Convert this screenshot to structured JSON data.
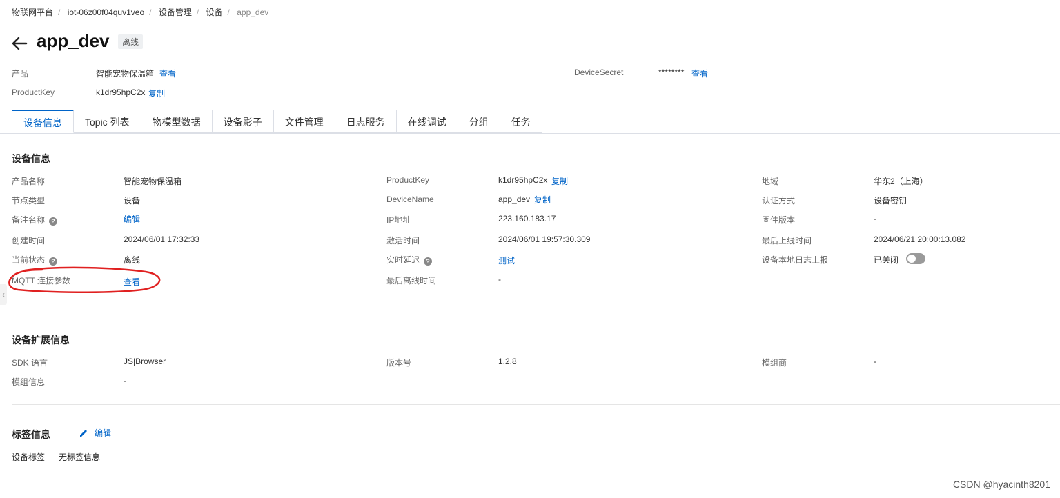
{
  "breadcrumb": [
    "物联网平台",
    "iot-06z00f04quv1veo",
    "设备管理",
    "设备",
    "app_dev"
  ],
  "device": {
    "name": "app_dev",
    "status": "离线"
  },
  "summary": {
    "product_label": "产品",
    "product_value": "智能宠物保温箱",
    "product_link": "查看",
    "productkey_label": "ProductKey",
    "productkey_value": "k1dr95hpC2x",
    "productkey_link": "复制",
    "secret_label": "DeviceSecret",
    "secret_value": "********",
    "secret_link": "查看"
  },
  "tabs": [
    "设备信息",
    "Topic 列表",
    "物模型数据",
    "设备影子",
    "文件管理",
    "日志服务",
    "在线调试",
    "分组",
    "任务"
  ],
  "device_info": {
    "title": "设备信息",
    "col1": [
      {
        "label": "产品名称",
        "value": "智能宠物保温箱"
      },
      {
        "label": "节点类型",
        "value": "设备"
      },
      {
        "label": "备注名称",
        "value": "编辑"
      },
      {
        "label": "创建时间",
        "value": "2024/06/01 17:32:33"
      },
      {
        "label": "当前状态",
        "value": "离线"
      },
      {
        "label": "MQTT 连接参数",
        "value": "查看"
      }
    ],
    "col2": [
      {
        "label": "ProductKey",
        "value": "k1dr95hpC2x",
        "link": "复制"
      },
      {
        "label": "DeviceName",
        "value": "app_dev",
        "link": "复制"
      },
      {
        "label": "IP地址",
        "value": "223.160.183.17"
      },
      {
        "label": "激活时间",
        "value": "2024/06/01 19:57:30.309"
      },
      {
        "label": "实时延迟",
        "value": "测试"
      },
      {
        "label": "最后离线时间",
        "value": "-"
      }
    ],
    "col3": [
      {
        "label": "地域",
        "value": "华东2（上海）"
      },
      {
        "label": "认证方式",
        "value": "设备密钥"
      },
      {
        "label": "固件版本",
        "value": "-"
      },
      {
        "label": "最后上线时间",
        "value": "2024/06/21 20:00:13.082"
      },
      {
        "label": "设备本地日志上报",
        "value": "已关闭"
      }
    ]
  },
  "ext_info": {
    "title": "设备扩展信息",
    "sdk_label": "SDK 语言",
    "sdk_value": "JS|Browser",
    "ver_label": "版本号",
    "ver_value": "1.2.8",
    "vendor_label": "模组商",
    "vendor_value": "-",
    "module_label": "模组信息",
    "module_value": "-"
  },
  "tag_info": {
    "title": "标签信息",
    "edit": "编辑",
    "label": "设备标签",
    "value": "无标签信息"
  },
  "watermark": "CSDN @hyacinth8201",
  "colors": {
    "link": "#0064c8",
    "annotation": "#e02020"
  }
}
